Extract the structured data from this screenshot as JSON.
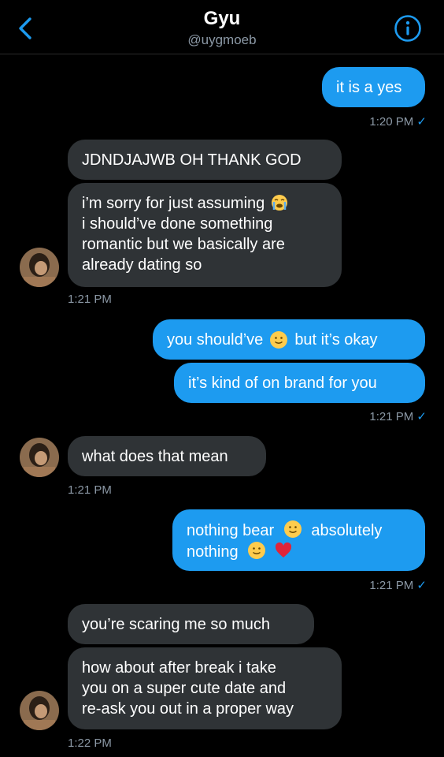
{
  "header": {
    "title": "Gyu",
    "handle": "@uygmoeb"
  },
  "messages": [
    {
      "text": "it is a yes"
    },
    {
      "time": "1:20 PM",
      "check": "✓"
    },
    {
      "text": "JDNDJAJWB OH THANK GOD"
    },
    {
      "line1": "i’m sorry for just assuming",
      "line2": "i should’ve done something",
      "line3": "romantic but we basically are",
      "line4": "already dating so"
    },
    {
      "time": "1:21 PM"
    },
    {
      "part1": "you should’ve",
      "part2": "but it’s okay"
    },
    {
      "text": "it’s kind of on brand for you"
    },
    {
      "time": "1:21 PM",
      "check": "✓"
    },
    {
      "text": "what does that mean"
    },
    {
      "time": "1:21 PM"
    },
    {
      "line1a": "nothing bear",
      "line1b": "absolutely",
      "line2": "nothing"
    },
    {
      "time": "1:21 PM",
      "check": "✓"
    },
    {
      "text": "you’re scaring me so much"
    },
    {
      "line1": "how about after break i take",
      "line2": "you on a super cute date and",
      "line3": "re-ask you out in a proper way"
    },
    {
      "time": "1:22 PM"
    }
  ],
  "colors": {
    "outgoing": "#1d9bf0",
    "incoming": "#2f3336",
    "meta": "#8b98a5",
    "accent": "#1d9bf0"
  },
  "icons": [
    "back-chevron-icon",
    "info-icon",
    "slightly-smiling-face-emoji",
    "loudly-crying-face-emoji",
    "red-heart-emoji"
  ]
}
